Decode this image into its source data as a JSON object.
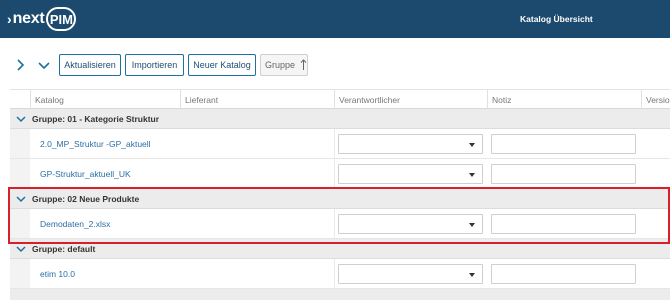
{
  "header": {
    "logo_text": "nextPIM",
    "logo_part_next": "next",
    "logo_part_pim": "PIM",
    "title": "Katalog Übersicht",
    "background": "#1b4a6e"
  },
  "toolbar": {
    "expand_icon": "chevron-right-icon",
    "collapse_icon": "chevron-down-icon",
    "refresh_label": "Aktualisieren",
    "import_label": "Importieren",
    "new_catalog_label": "Neuer Katalog",
    "group_chip_label": "Gruppe",
    "group_sort_icon": "arrow-up-icon"
  },
  "columns": [
    "Katalog",
    "Lieferant",
    "Verantwortlicher",
    "Notiz",
    "Version"
  ],
  "groups": [
    {
      "label": "Gruppe: 01 - Kategorie Struktur",
      "rows": [
        {
          "catalog": "2.0_MP_Struktur -GP_aktuell"
        },
        {
          "catalog": "GP-Struktur_aktuell_UK"
        }
      ]
    },
    {
      "label": "Gruppe: 02 Neue Produkte",
      "rows": [
        {
          "catalog": "Demodaten_2.xlsx"
        }
      ]
    },
    {
      "label": "Gruppe: default",
      "rows": [
        {
          "catalog": "etim 10.0"
        }
      ]
    }
  ],
  "colors": {
    "accent": "#1f6f9f",
    "link": "#2a6fa5",
    "highlight": "#d8202a",
    "group_bg": "#ececec"
  }
}
